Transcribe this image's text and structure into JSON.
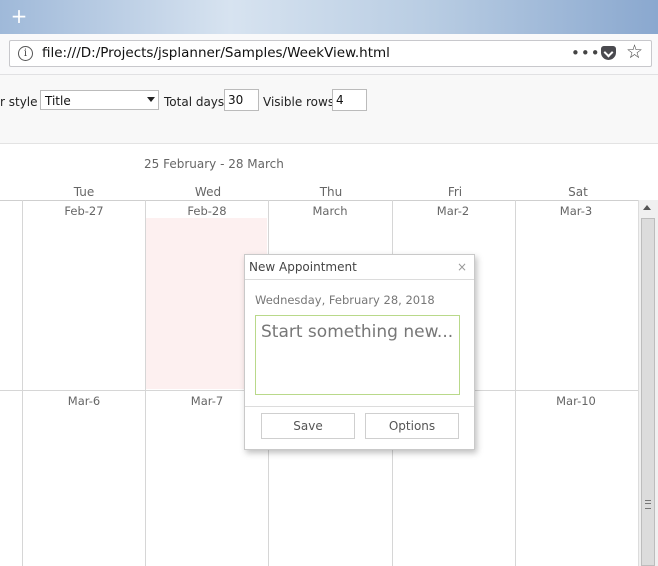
{
  "browser": {
    "url": "file:///D:/Projects/jsplanner/Samples/WeekView.html",
    "new_tab_icon": "+",
    "info_icon": "i",
    "more_icon": "•••",
    "star_icon": "☆"
  },
  "toolbar": {
    "header_style_label": "r style",
    "header_style_value": "Title",
    "total_days_label": "Total days",
    "total_days_value": "30",
    "visible_rows_label": "Visible rows",
    "visible_rows_value": "4"
  },
  "calendar": {
    "range_title": "25 February - 28 March",
    "day_headers": [
      "Tue",
      "Wed",
      "Thu",
      "Fri",
      "Sat"
    ],
    "week1_dates": [
      "Feb-27",
      "Feb-28",
      "March",
      "Mar-2",
      "Mar-3"
    ],
    "week2_dates": [
      "Mar-6",
      "Mar-7",
      "Mar-10"
    ]
  },
  "dialog": {
    "title": "New Appointment",
    "close_icon": "×",
    "date": "Wednesday, February 28, 2018",
    "placeholder": "Start something new...",
    "save_label": "Save",
    "options_label": "Options"
  }
}
